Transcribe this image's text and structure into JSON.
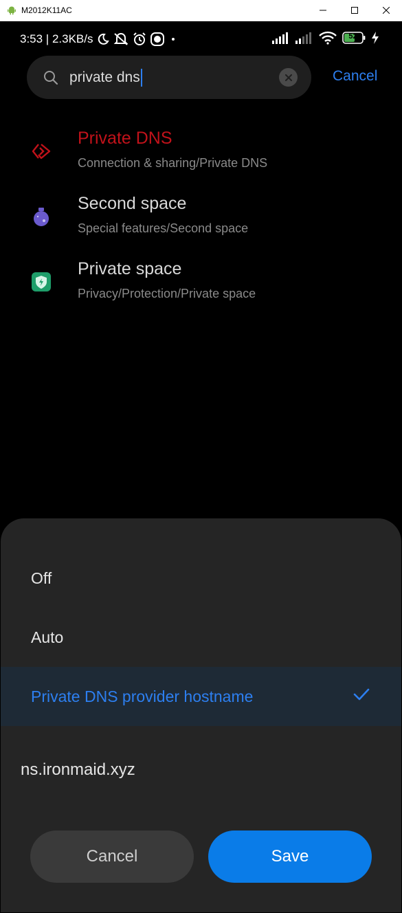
{
  "window": {
    "title": "M2012K11AC"
  },
  "status_bar": {
    "time_speed": "3:53 | 2.3KB/s",
    "battery_level": "52"
  },
  "search": {
    "query": "private dns",
    "cancel_label": "Cancel"
  },
  "results": [
    {
      "title": "Private DNS",
      "subtitle": "Connection & sharing/Private DNS",
      "icon": "private-dns-icon"
    },
    {
      "title": "Second space",
      "subtitle": "Special features/Second space",
      "icon": "second-space-icon"
    },
    {
      "title": "Private space",
      "subtitle": "Privacy/Protection/Private space",
      "icon": "shield-icon"
    }
  ],
  "dns_dialog": {
    "options": [
      {
        "label": "Off",
        "selected": false
      },
      {
        "label": "Auto",
        "selected": false
      },
      {
        "label": "Private DNS provider hostname",
        "selected": true
      }
    ],
    "hostname": "ns.ironmaid.xyz",
    "cancel_label": "Cancel",
    "save_label": "Save"
  },
  "colors": {
    "accent": "#2d7ff0",
    "active_result": "#c1121a",
    "save_button": "#0a7ce8"
  }
}
